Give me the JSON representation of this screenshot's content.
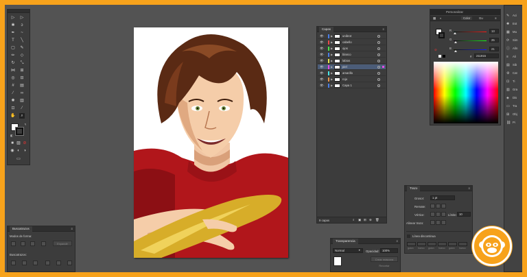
{
  "layers_panel": {
    "tab": "Capas",
    "rows": [
      {
        "name": "unibrot",
        "color": "#4a7fe8"
      },
      {
        "name": "cabello",
        "color": "#e84a4a"
      },
      {
        "name": "ojos",
        "color": "#4ae84a"
      },
      {
        "name": "blanco",
        "color": "#4a7fe8"
      },
      {
        "name": "labios",
        "color": "#e8e84a"
      },
      {
        "name": "piel",
        "color": "#e84ae8"
      },
      {
        "name": "amarillo",
        "color": "#4ae8e8"
      },
      {
        "name": "rojo",
        "color": "#e8944a"
      },
      {
        "name": "Capa 1",
        "color": "#4a7fe8"
      }
    ],
    "footer": "9 capas"
  },
  "color_panel": {
    "tabs": [
      "Color",
      "Gu"
    ],
    "channels": [
      {
        "label": "R",
        "value": "13"
      },
      {
        "label": "G",
        "value": "25"
      },
      {
        "label": "B",
        "value": "21"
      }
    ],
    "hex_prefix": "#",
    "hex_value": "211915",
    "header_tab": "Personalizar"
  },
  "stroke_panel": {
    "tab": "Trazo",
    "weight_label": "Grosor:",
    "weight_value": "1 pt",
    "cap_label": "Remate:",
    "corner_label": "Vértice:",
    "limit_label": "Límite:",
    "limit_value": "10",
    "align_label": "Alinear trazo:",
    "dashed_label": "Línea discontinua",
    "dash_labels": [
      "guion",
      "hueco",
      "guion",
      "hueco",
      "guion",
      "hueco"
    ]
  },
  "pathfinder_panel": {
    "tab": "Buscatrazos",
    "shape_modes_label": "Modos de forma:",
    "expand_label": "Expandir",
    "pathfinders_label": "Buscatrazos:"
  },
  "transparency_panel": {
    "tab": "Transparencia",
    "blend_mode": "Normal",
    "opacity_label": "Opacidad:",
    "opacity_value": "100%",
    "make_mask_label": "Crear máscara",
    "clip_label": "Recortar"
  },
  "right_dock": {
    "items": [
      {
        "icon": "brush-icon",
        "label": "Aci"
      },
      {
        "icon": "spray-icon",
        "label": "Est"
      },
      {
        "icon": "swatch-icon",
        "label": "Mu"
      },
      {
        "icon": "sync-icon",
        "label": "Sim"
      },
      {
        "icon": "info-icon",
        "label": "Alín"
      },
      {
        "icon": "bars-icon",
        "label": "Ali"
      },
      {
        "icon": "lib-icon",
        "label": "Sib"
      },
      {
        "icon": "gear-icon",
        "label": "Cat"
      },
      {
        "icon": "transform-icon",
        "label": "Ti"
      },
      {
        "icon": "chart-icon",
        "label": "Gra"
      },
      {
        "icon": "layers-icon",
        "label": "Dis"
      },
      {
        "icon": "doc-icon",
        "label": "Tra"
      },
      {
        "icon": "grid-icon",
        "label": "Obj"
      },
      {
        "icon": "link-icon",
        "label": "Pi"
      }
    ]
  },
  "brand": {
    "accent": "#f7a21b"
  }
}
